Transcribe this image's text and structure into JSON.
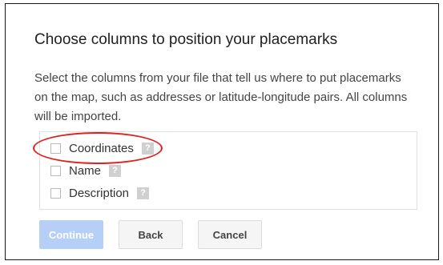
{
  "dialog": {
    "title": "Choose columns to position your placemarks",
    "description": "Select the columns from your file that tell us where to put placemarks on the map, such as addresses or latitude-longitude pairs. All columns will be imported."
  },
  "options": [
    {
      "label": "Coordinates",
      "checked": false,
      "help_icon": "question-mark"
    },
    {
      "label": "Name",
      "checked": false,
      "help_icon": "question-mark"
    },
    {
      "label": "Description",
      "checked": false,
      "help_icon": "question-mark"
    }
  ],
  "help_glyph": "?",
  "buttons": {
    "continue_label": "Continue",
    "back_label": "Back",
    "cancel_label": "Cancel"
  },
  "colors": {
    "continue_disabled_bg": "#b6cff6",
    "highlight": "#e0201e",
    "help_icon_bg": "#d0d0d0"
  }
}
